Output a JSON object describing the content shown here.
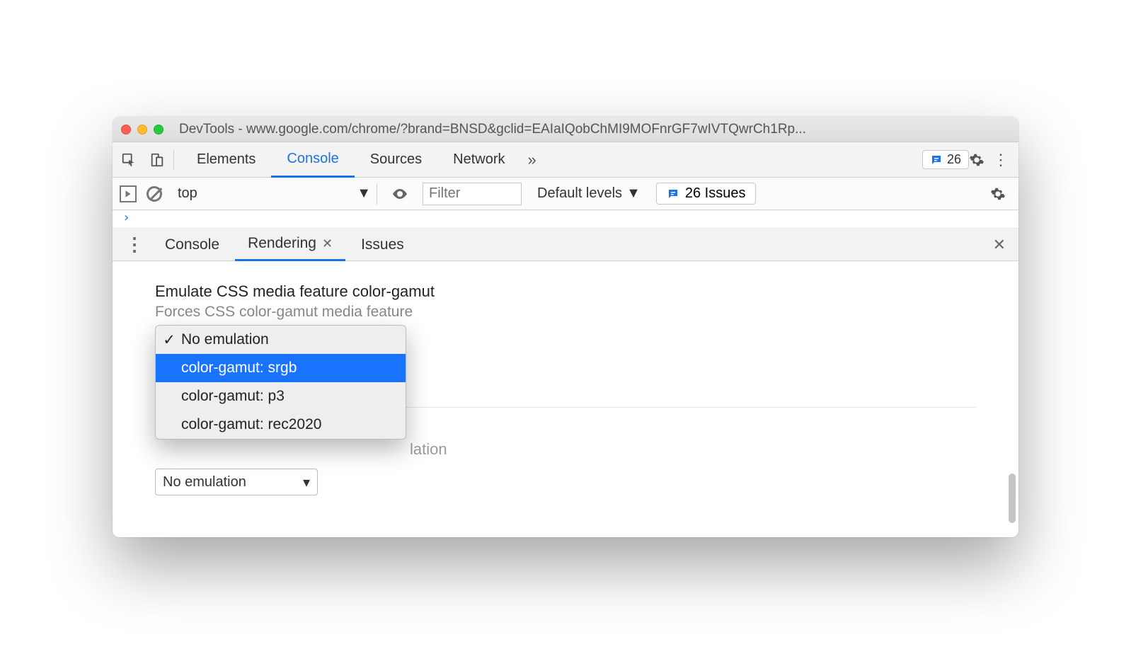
{
  "window": {
    "title": "DevTools - www.google.com/chrome/?brand=BNSD&gclid=EAIaIQobChMI9MOFnrGF7wIVTQwrCh1Rp..."
  },
  "maintabs": {
    "items": [
      "Elements",
      "Console",
      "Sources",
      "Network"
    ],
    "active_index": 1,
    "overflow_glyph": "»"
  },
  "issuesBadge": {
    "count": "26"
  },
  "consoleToolbar": {
    "context": "top",
    "filter_placeholder": "Filter",
    "levels_label": "Default levels",
    "issues_label": "26 Issues"
  },
  "prompt_glyph": "›",
  "drawer": {
    "tabs": [
      "Console",
      "Rendering",
      "Issues"
    ],
    "active_index": 1
  },
  "rendering": {
    "section_title": "Emulate CSS media feature color-gamut",
    "section_desc": "Forces CSS color-gamut media feature",
    "dropdown": {
      "options": [
        "No emulation",
        "color-gamut: srgb",
        "color-gamut: p3",
        "color-gamut: rec2020"
      ],
      "checked_index": 0,
      "highlight_index": 1
    },
    "obscured_desc_tail": "lation",
    "next_select_value": "No emulation"
  }
}
